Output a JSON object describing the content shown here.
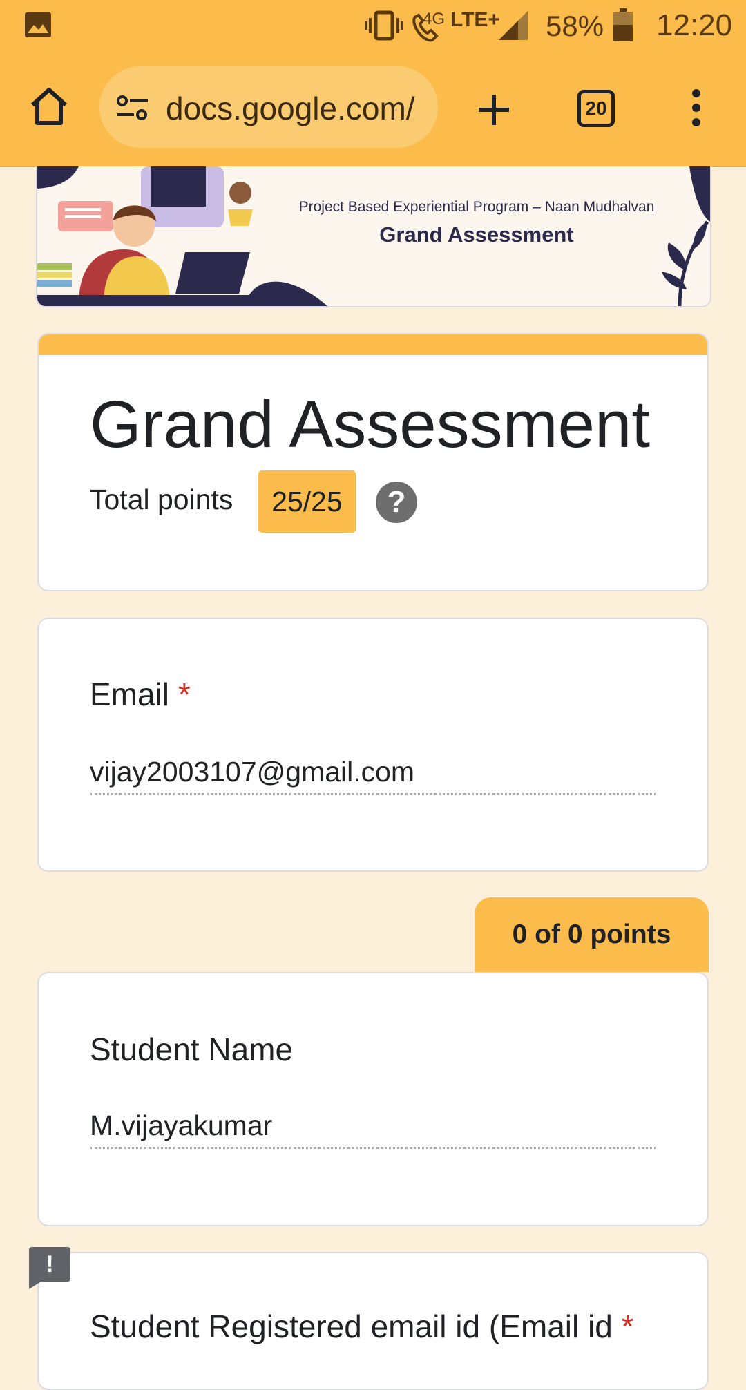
{
  "status_bar": {
    "network": "4G",
    "network_type": "LTE+",
    "battery": "58%",
    "time": "12:20"
  },
  "browser": {
    "url": "docs.google.com/",
    "tab_count": "20"
  },
  "banner": {
    "subtitle": "Project Based Experiential Program – Naan Mudhalvan",
    "title": "Grand Assessment"
  },
  "form": {
    "title": "Grand Assessment",
    "total_points_label": "Total points",
    "total_points_value": "25/25",
    "help_glyph": "?"
  },
  "email_question": {
    "label": "Email",
    "required_marker": "*",
    "answer": "vijay2003107@gmail.com"
  },
  "section_points": "0 of 0 points",
  "name_question": {
    "label": "Student Name",
    "answer": "M.vijayakumar"
  },
  "registered_email_question": {
    "label": "Student Registered email id (Email id",
    "required_marker": "*"
  },
  "icons": [
    "image-icon",
    "vibrate-icon",
    "wifi-calling-icon",
    "signal-icon",
    "battery-icon",
    "home-icon",
    "site-settings-icon",
    "new-tab-icon",
    "tab-switcher-icon",
    "more-options-icon",
    "help-icon",
    "feedback-icon"
  ],
  "colors": {
    "accent": "#fbbc4c",
    "page_background": "#fdf0da",
    "required": "#d93025"
  }
}
